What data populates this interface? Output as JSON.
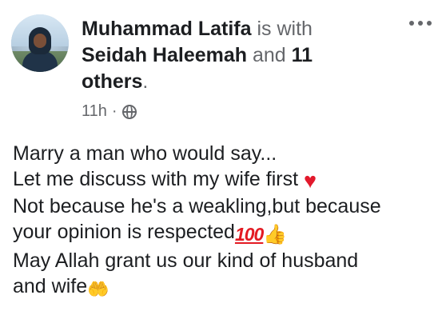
{
  "post": {
    "author": "Muhammad Latifa",
    "is_with_text": " is with ",
    "tagged_name": "Seidah Haleemah",
    "and_text": " and ",
    "others_count": "11 others",
    "period": ".",
    "time": "11h",
    "separator": "·",
    "privacy_icon": "globe-icon",
    "menu_icon": "more-options-icon",
    "lines": [
      "Marry a man who would say...",
      "Let me discuss with my wife first",
      "Not because he's a weakling,but because",
      "your opinion is respected",
      "May Allah grant us our kind of husband",
      "and wife"
    ],
    "emojis": {
      "heart": "♥",
      "hundred": "100",
      "thumbs": "👍",
      "hands": "🤲"
    }
  }
}
